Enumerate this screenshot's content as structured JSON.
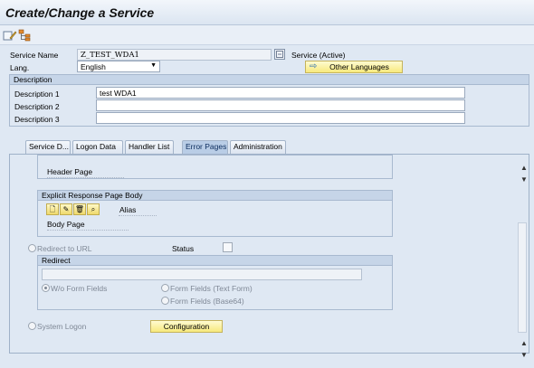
{
  "window": {
    "title": "Create/Change a Service"
  },
  "toolbar": {
    "icons": [
      "display-change-icon",
      "hierarchy-icon"
    ]
  },
  "header": {
    "service_name_label": "Service Name",
    "service_name_value": "Z_TEST_WDA1",
    "service_status": "Service (Active)",
    "lang_label": "Lang.",
    "lang_value": "English",
    "other_languages_label": "Other Languages"
  },
  "description": {
    "group_title": "Description",
    "rows": [
      {
        "label": "Description 1",
        "value": "test WDA1"
      },
      {
        "label": "Description 2",
        "value": ""
      },
      {
        "label": "Description 3",
        "value": ""
      }
    ]
  },
  "tabs": [
    {
      "label": "Service D...",
      "active": false
    },
    {
      "label": "Logon Data",
      "active": false
    },
    {
      "label": "Handler List",
      "active": false
    },
    {
      "label": "Error Pages",
      "active": true
    },
    {
      "label": "Administration",
      "active": false
    }
  ],
  "error_pages": {
    "header_page_label": "Header Page",
    "explicit_body": {
      "group_title": "Explicit Response Page Body",
      "alias_label": "Alias",
      "body_page_label": "Body Page"
    },
    "redirect_to_url_label": "Redirect to URL",
    "status_label": "Status",
    "redirect": {
      "group_title": "Redirect",
      "url_value": "",
      "wo_form_fields_label": "W/o Form Fields",
      "form_fields_text_label": "Form Fields (Text Form)",
      "form_fields_base64_label": "Form Fields (Base64)"
    },
    "system_logon_label": "System Logon",
    "configuration_label": "Configuration"
  },
  "colors": {
    "background": "#dfe8f3",
    "group_header": "#c6d5e8",
    "active_tab": "#b9cde6",
    "button_yellow": "#f7e97c"
  }
}
